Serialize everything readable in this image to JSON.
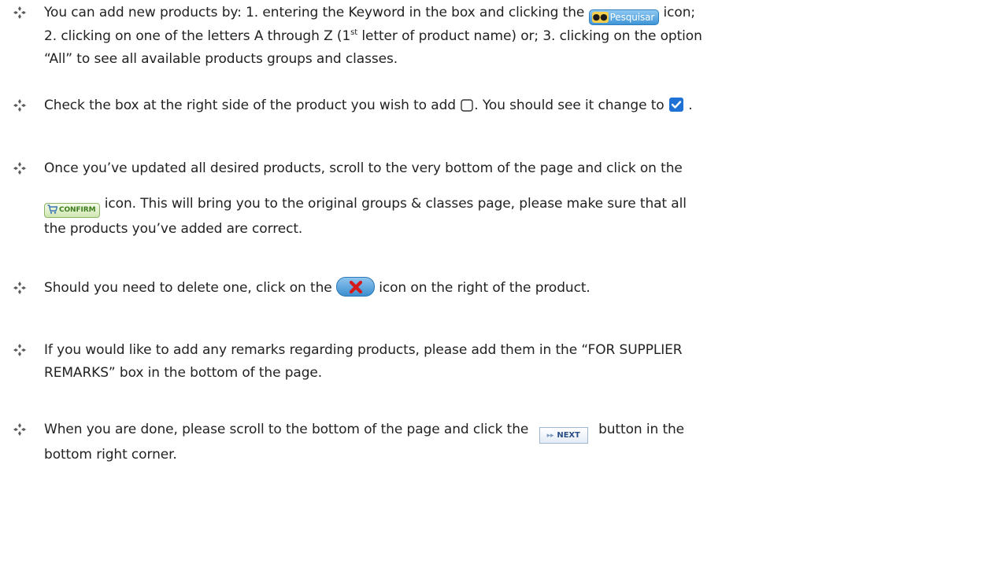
{
  "bullets": [
    {
      "id": "add-products",
      "line1_a": "You can add new products by: 1. entering the Keyword in the box and clicking the ",
      "pesquisar_label": "Pesquisar",
      "line1_b": " icon;",
      "line2_a": "2. clicking on one of the letters A through Z (1",
      "line2_sup": "st",
      "line2_b": " letter of product name) or; 3. clicking on the option",
      "line3": "“All” to see all available products groups and classes."
    },
    {
      "id": "check-box",
      "line1_a": "Check the box at the right side of the product you wish to add ",
      "line1_b": ". You should see it change to ",
      "line1_c": " ."
    },
    {
      "id": "confirm",
      "line1": "Once you’ve updated all desired products, scroll to the very bottom of the page and click on the",
      "confirm_label": "CONFIRM",
      "line2": " icon. This will bring you to the original groups & classes page, please make sure that all",
      "line3": "the products you’ve added are correct."
    },
    {
      "id": "delete",
      "line1_a": "Should you need to delete one, click on the ",
      "line1_b": " icon on the right of the product."
    },
    {
      "id": "remarks",
      "line1": "If you would like to add any remarks regarding products, please add them in the “FOR SUPPLIER",
      "line2": "REMARKS” box in the bottom of the page."
    },
    {
      "id": "next",
      "line1_a": "When you are done, please scroll to the bottom of the page and click the ",
      "next_label": "NEXT",
      "line1_b": " button in the",
      "line2": "bottom right corner."
    }
  ],
  "icons": {
    "bullet": "four-diamond-bullet-icon",
    "pesquisar": "binoculars-icon",
    "unchecked": "unchecked-box-icon",
    "checked": "checked-box-icon",
    "cart": "cart-icon",
    "delete": "delete-x-icon",
    "next_arrows": "double-arrow-icon"
  },
  "colors": {
    "bullet": "#5a5a5a",
    "pesquisar_bg": "#3f95d6",
    "confirm_text": "#3d7d1f",
    "checked_blue": "#1e72d6",
    "delete_x_red": "#d41a1a"
  }
}
